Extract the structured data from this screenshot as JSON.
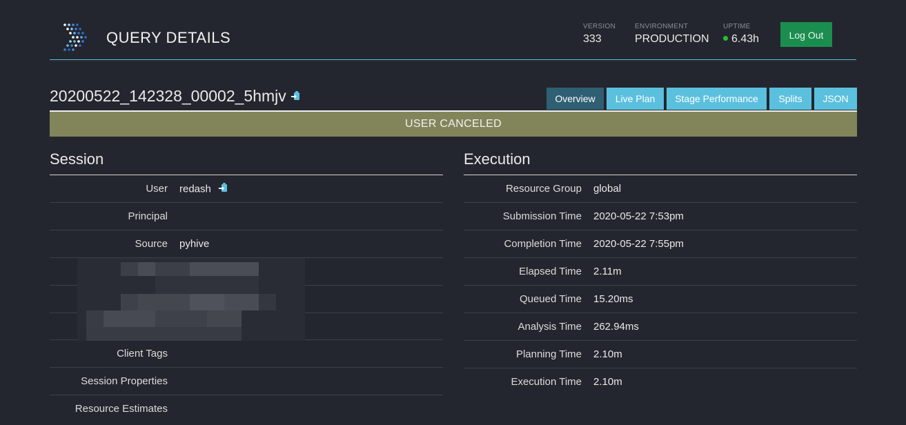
{
  "header": {
    "title": "QUERY DETAILS",
    "version_label": "VERSION",
    "version_value": "333",
    "environment_label": "ENVIRONMENT",
    "environment_value": "PRODUCTION",
    "uptime_label": "UPTIME",
    "uptime_value": "6.43h",
    "logout_label": "Log Out"
  },
  "query": {
    "id": "20200522_142328_00002_5hmjv",
    "state": "USER CANCELED"
  },
  "tabs": [
    {
      "label": "Overview",
      "active": true
    },
    {
      "label": "Live Plan",
      "active": false
    },
    {
      "label": "Stage Performance",
      "active": false
    },
    {
      "label": "Splits",
      "active": false
    },
    {
      "label": "JSON",
      "active": false
    }
  ],
  "session": {
    "title": "Session",
    "rows": [
      {
        "key": "User",
        "value": "redash"
      },
      {
        "key": "Principal",
        "value": ""
      },
      {
        "key": "Source",
        "value": "pyhive"
      },
      {
        "key": "Client Tags",
        "value": ""
      },
      {
        "key": "Session Properties",
        "value": ""
      },
      {
        "key": "Resource Estimates",
        "value": ""
      }
    ]
  },
  "execution": {
    "title": "Execution",
    "rows": [
      {
        "key": "Resource Group",
        "value": "global"
      },
      {
        "key": "Submission Time",
        "value": "2020-05-22 7:53pm"
      },
      {
        "key": "Completion Time",
        "value": "2020-05-22 7:55pm"
      },
      {
        "key": "Elapsed Time",
        "value": "2.11m"
      },
      {
        "key": "Queued Time",
        "value": "15.20ms"
      },
      {
        "key": "Analysis Time",
        "value": "262.94ms"
      },
      {
        "key": "Planning Time",
        "value": "2.10m"
      },
      {
        "key": "Execution Time",
        "value": "2.10m"
      }
    ]
  },
  "colors": {
    "background": "#24262f",
    "accent": "#4ec3d8",
    "tab": "#5bc0de",
    "tab_active": "#2f5f72",
    "status_canceled": "#82855a",
    "logout": "#1b8d4f",
    "uptime_dot": "#25c12a"
  },
  "icons": {
    "logo": "presto-logo-icon",
    "clipboard": "clipboard-copy-icon"
  }
}
